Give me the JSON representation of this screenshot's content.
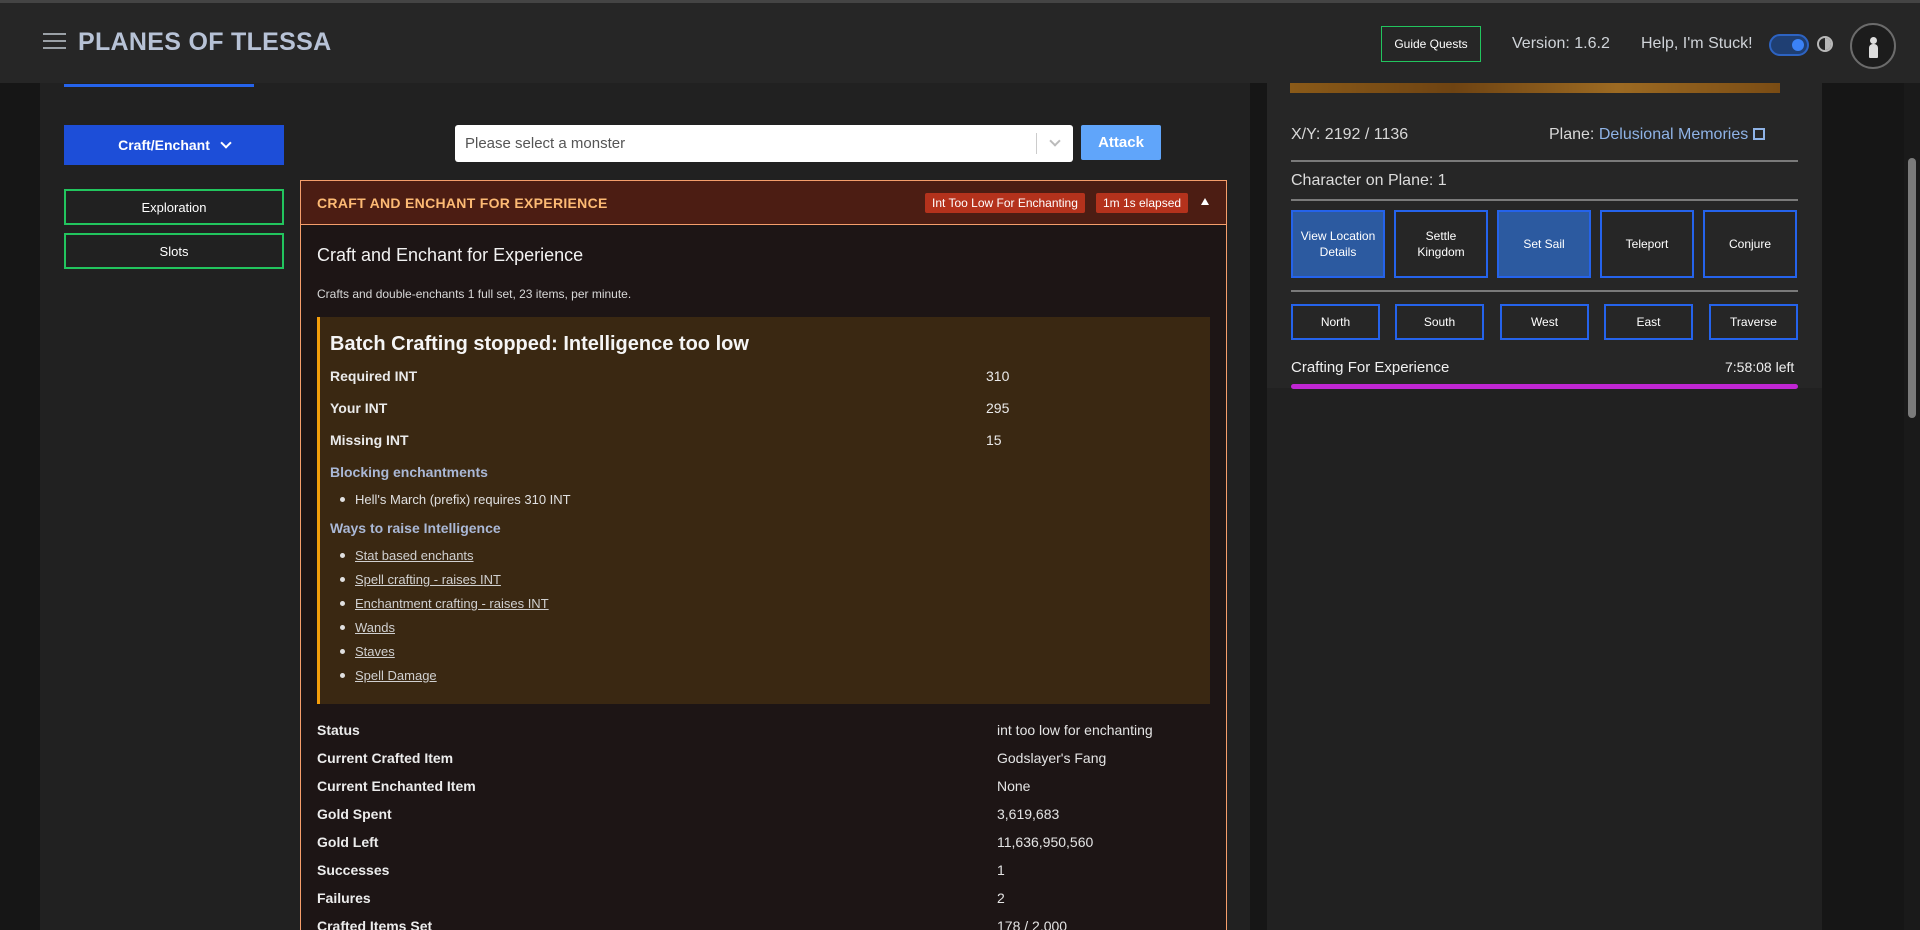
{
  "header": {
    "brand": "PLANES OF TLESSA",
    "guide_quests": "Guide Quests",
    "version": "Version: 1.6.2",
    "help": "Help, I'm Stuck!"
  },
  "left_nav": {
    "craft_label": "Craft/Enchant",
    "exploration": "Exploration",
    "slots": "Slots"
  },
  "monster_select": {
    "placeholder": "Please select a monster"
  },
  "attack_label": "Attack",
  "craft_card": {
    "header_title": "CRAFT AND ENCHANT FOR EXPERIENCE",
    "badge_status": "Int Too Low For Enchanting",
    "badge_elapsed": "1m 1s elapsed",
    "title": "Craft and Enchant for Experience",
    "description": "Crafts and double-enchants 1 full set, 23 items, per minute.",
    "stopped": {
      "heading": "Batch Crafting stopped: Intelligence too low",
      "required_label": "Required INT",
      "required_value": "310",
      "your_label": "Your INT",
      "your_value": "295",
      "missing_label": "Missing INT",
      "missing_value": "15",
      "blocking_heading": "Blocking enchantments",
      "blocking_items": [
        "Hell's March (prefix) requires 310 INT"
      ],
      "ways_heading": "Ways to raise Intelligence",
      "ways_items": [
        "Stat based enchants",
        "Spell crafting - raises INT",
        "Enchantment crafting - raises INT",
        "Wands",
        "Staves",
        "Spell Damage"
      ]
    },
    "stats": [
      {
        "label": "Status",
        "value": "int too low for enchanting"
      },
      {
        "label": "Current Crafted Item",
        "value": "Godslayer's Fang"
      },
      {
        "label": "Current Enchanted Item",
        "value": "None"
      },
      {
        "label": "Gold Spent",
        "value": "3,619,683"
      },
      {
        "label": "Gold Left",
        "value": "11,636,950,560"
      },
      {
        "label": "Successes",
        "value": "1"
      },
      {
        "label": "Failures",
        "value": "2"
      },
      {
        "label": "Crafted Items Set",
        "value": "178 / 2,000"
      }
    ]
  },
  "right_panel": {
    "coords": "X/Y: 2192 / 1136",
    "plane_label": "Plane:",
    "plane_value": "Delusional Memories",
    "character_on_plane": "Character on Plane: 1",
    "actions": [
      "View Location Details",
      "Settle Kingdom",
      "Set Sail",
      "Teleport",
      "Conjure"
    ],
    "directions": [
      "North",
      "South",
      "West",
      "East",
      "Traverse"
    ],
    "crafting_label": "Crafting For Experience",
    "crafting_time": "7:58:08 left",
    "crafting_progress": 1.0
  },
  "colors": {
    "accent_blue": "#1d4ed8",
    "green_border": "#22c55e",
    "card_border": "#f59e6b",
    "progress": "#c026d3"
  }
}
